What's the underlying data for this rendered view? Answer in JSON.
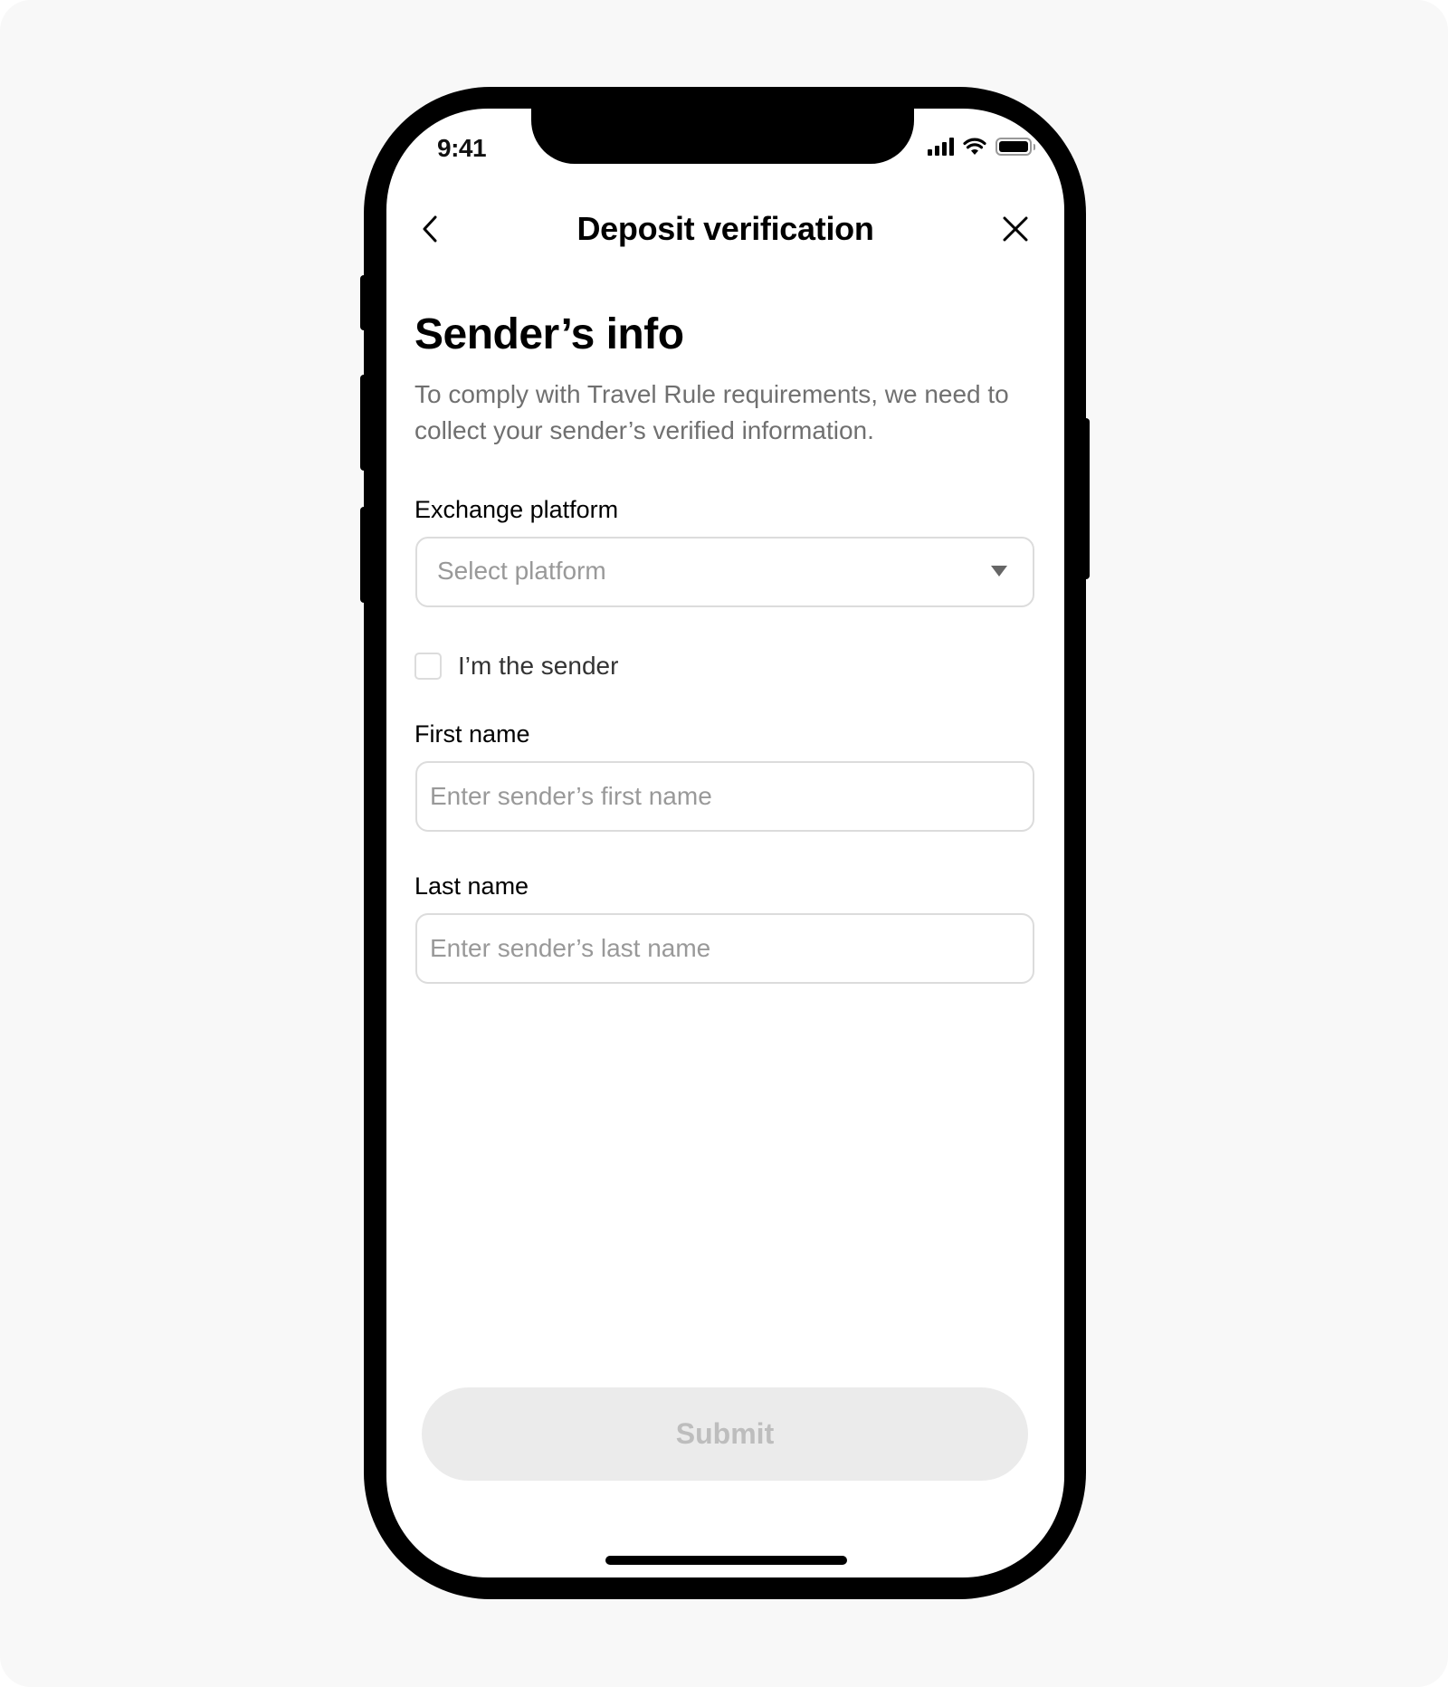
{
  "status_bar": {
    "time": "9:41",
    "icons": [
      "cellular-signal-icon",
      "wifi-icon",
      "battery-icon"
    ]
  },
  "nav": {
    "title": "Deposit verification",
    "back_icon": "chevron-left-icon",
    "close_icon": "close-icon"
  },
  "content": {
    "heading": "Sender’s info",
    "description": "To comply with Travel Rule requirements, we need to collect your sender’s verified information."
  },
  "form": {
    "exchange_platform": {
      "label": "Exchange platform",
      "placeholder": "Select platform",
      "value": ""
    },
    "im_the_sender": {
      "label": "I’m the sender",
      "checked": false
    },
    "first_name": {
      "label": "First name",
      "placeholder": "Enter sender’s first name",
      "value": ""
    },
    "last_name": {
      "label": "Last name",
      "placeholder": "Enter sender’s last name",
      "value": ""
    }
  },
  "actions": {
    "submit_label": "Submit",
    "submit_enabled": false
  },
  "colors": {
    "background": "#f8f8f8",
    "frame": "#000000",
    "text_primary": "#000000",
    "text_secondary": "#707070",
    "placeholder": "#999999",
    "border": "#dcdcdc",
    "button_disabled_bg": "#ebebeb",
    "button_disabled_text": "#bdbdbd"
  }
}
